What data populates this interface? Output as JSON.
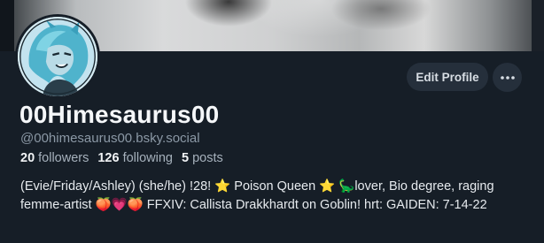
{
  "profile": {
    "display_name": "00Himesaurus00",
    "handle": "@00himesaurus00.bsky.social",
    "stats": {
      "followers_count": "20",
      "followers_label": "followers",
      "following_count": "126",
      "following_label": "following",
      "posts_count": "5",
      "posts_label": "posts"
    },
    "bio": "(Evie/Friday/Ashley) (she/he) !28! ⭐ Poison Queen ⭐ 🦕lover, Bio degree, raging femme-artist 🍑💗🍑 FFXIV: Callista Drakkhardt on Goblin! hrt: GAIDEN: 7-14-22"
  },
  "actions": {
    "edit_profile_label": "Edit Profile",
    "more_icon": "ellipsis-icon"
  },
  "colors": {
    "background": "#161e27",
    "button_bg": "#252f3b",
    "muted_text": "#8b98a5"
  }
}
